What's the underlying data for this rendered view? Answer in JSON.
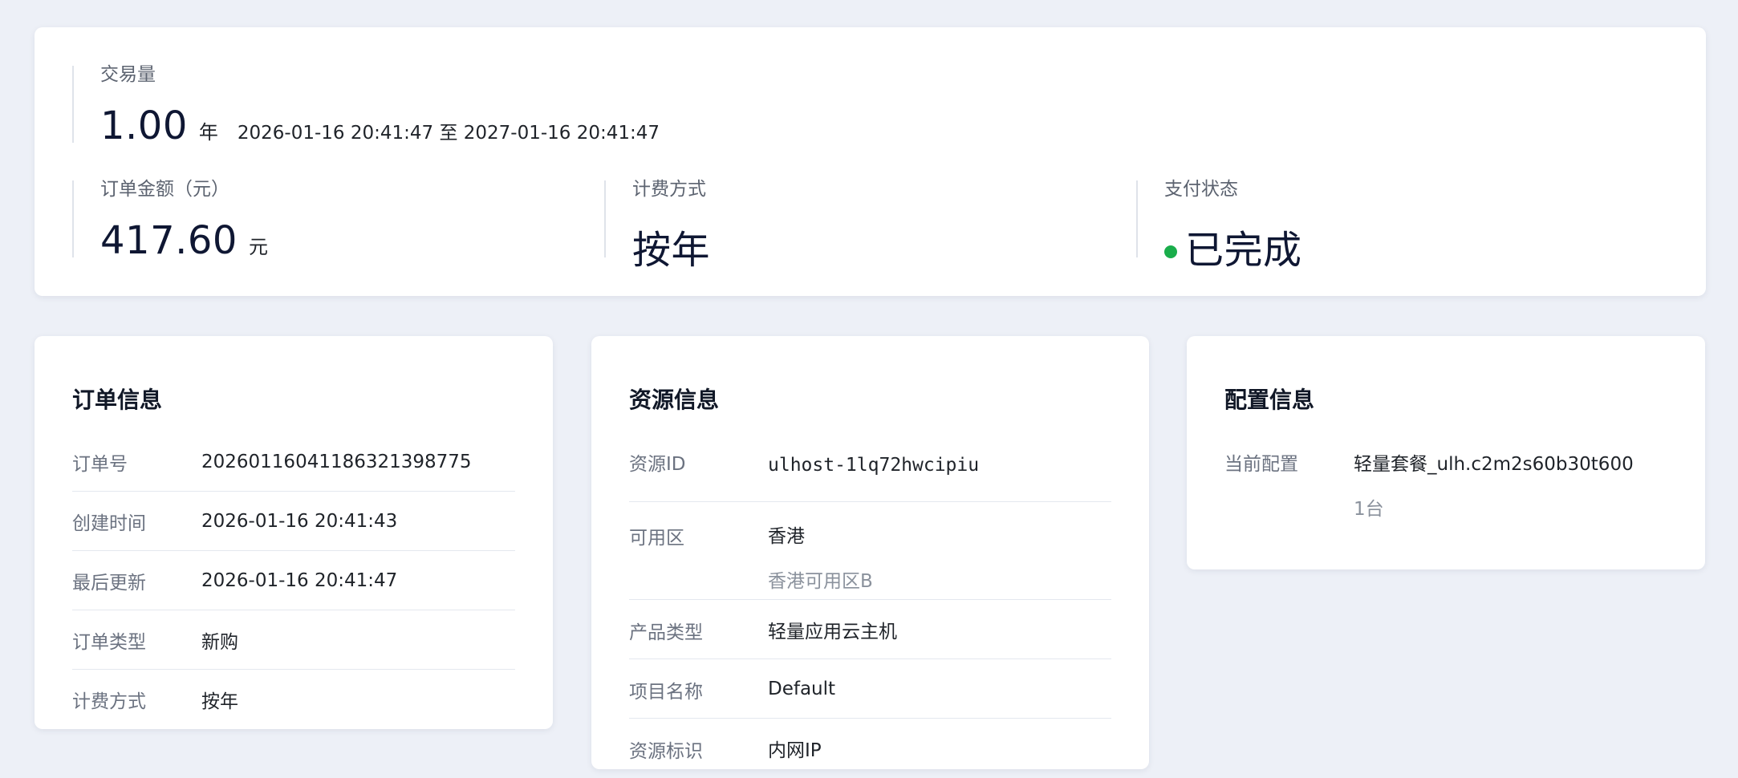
{
  "summary": {
    "quantity": {
      "label": "交易量",
      "value": "1.00",
      "unit": "年",
      "period": "2026-01-16 20:41:47 至 2027-01-16 20:41:47"
    },
    "amount": {
      "label": "订单金额（元）",
      "value": "417.60",
      "unit": "元"
    },
    "billing": {
      "label": "计费方式",
      "value": "按年"
    },
    "payment": {
      "label": "支付状态",
      "value": "已完成",
      "status_color": "#1aad4b"
    }
  },
  "order_info": {
    "title": "订单信息",
    "rows": [
      {
        "key": "订单号",
        "value": "2026011604118632139877​5"
      },
      {
        "key": "创建时间",
        "value": "2026-01-16 20:41:43"
      },
      {
        "key": "最后更新",
        "value": "2026-01-16 20:41:47"
      },
      {
        "key": "订单类型",
        "value": "新购"
      },
      {
        "key": "计费方式",
        "value": "按年"
      }
    ]
  },
  "resource_info": {
    "title": "资源信息",
    "rows": [
      {
        "key": "资源ID",
        "value": "ulhost-1lq72hwcipiu"
      },
      {
        "key": "可用区",
        "value": "香港",
        "sub": "香港可用区B"
      },
      {
        "key": "产品类型",
        "value": "轻量应用云主机"
      },
      {
        "key": "项目名称",
        "value": "Default"
      },
      {
        "key": "资源标识",
        "value": "内网IP"
      }
    ]
  },
  "config_info": {
    "title": "配置信息",
    "rows": [
      {
        "key": "当前配置",
        "value": "轻量套餐_ulh.c2m2s60b30t600",
        "sub": "1台"
      }
    ]
  }
}
